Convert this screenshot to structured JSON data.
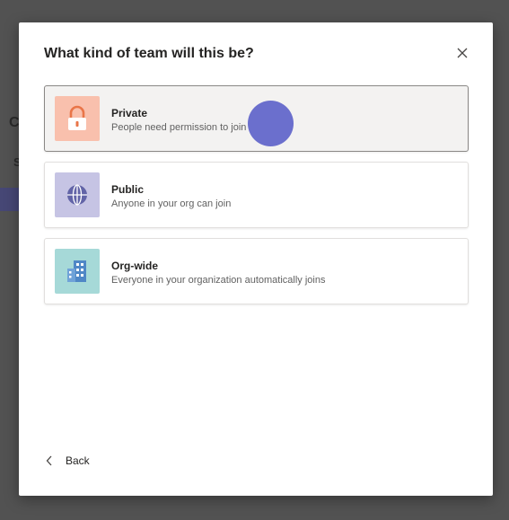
{
  "background": {
    "partial_text_1": "C",
    "partial_text_2": "S"
  },
  "dialog": {
    "title": "What kind of team will this be?",
    "close_icon": "close-icon",
    "options": [
      {
        "title": "Private",
        "description": "People need permission to join",
        "icon": "lock-icon",
        "icon_bg": "#f9c0ad",
        "icon_color": "#e97548",
        "selected": true
      },
      {
        "title": "Public",
        "description": "Anyone in your org can join",
        "icon": "globe-icon",
        "icon_bg": "#c6c4e4",
        "icon_color": "#6264a7",
        "selected": false
      },
      {
        "title": "Org-wide",
        "description": "Everyone in your organization automatically joins",
        "icon": "building-icon",
        "icon_bg": "#a6d9d8",
        "icon_color": "#4f87c6",
        "selected": false
      }
    ],
    "back_label": "Back",
    "back_icon": "chevron-left-icon"
  },
  "colors": {
    "overlay": "#525252",
    "selected_bg": "#f3f2f1",
    "cursor_highlight": "#6b6fcd"
  }
}
